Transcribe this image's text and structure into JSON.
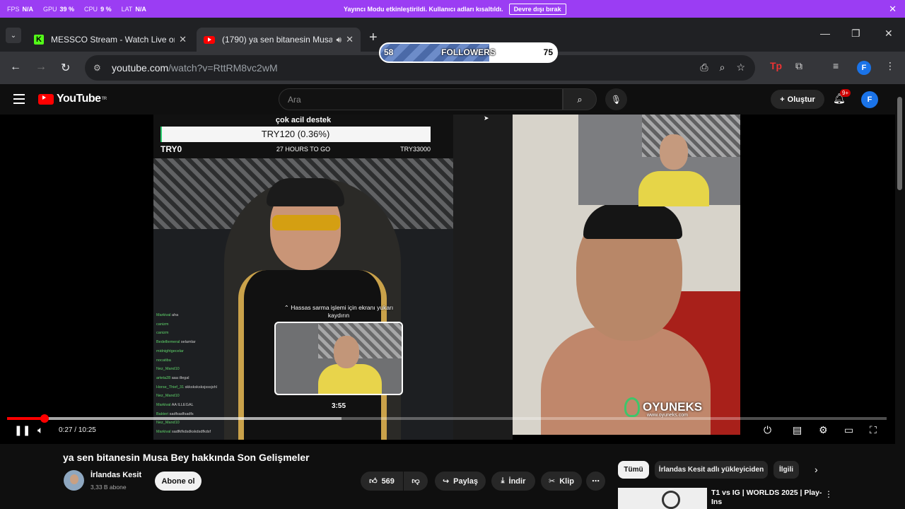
{
  "streamer_bar": {
    "stats": [
      {
        "label": "FPS",
        "value": "N/A"
      },
      {
        "label": "GPU",
        "value": "39 %"
      },
      {
        "label": "CPU",
        "value": "9 %"
      },
      {
        "label": "LAT",
        "value": "N/A"
      }
    ],
    "message": "Yayıncı Modu etkinleştirildi. Kullanıcı adları kısaltıldı.",
    "disable_button": "Devre dışı bırak",
    "color": "#9b3df3"
  },
  "tabs": [
    {
      "title": "MESSCO Stream - Watch Live on K",
      "icon": "kick-icon"
    },
    {
      "title": "(1790) ya sen bitanesin Musa B",
      "icon": "youtube-icon",
      "audio": true,
      "active": true
    }
  ],
  "followers_widget": {
    "label": "FOLLOWERS",
    "current": "58",
    "goal": "75",
    "progress": 0.62
  },
  "omnibox": {
    "url_host": "youtube.com",
    "url_path": "/watch?v=RttRM8vc2wM"
  },
  "profile_letter": "F",
  "youtube": {
    "logo_text": "YouTube",
    "logo_suffix": "TR",
    "search_placeholder": "Ara",
    "create_label": "Oluştur",
    "notification_count": "9+"
  },
  "video": {
    "donation": {
      "title": "çok acil destek",
      "amount": "TRY120 (0.36%)",
      "start": "TRY0",
      "remaining": "27 HOURS TO GO",
      "goal": "TRY33000"
    },
    "chat": [
      {
        "user": "Markival",
        "msg": "aha"
      },
      {
        "user": "canizm",
        "msg": ""
      },
      {
        "user": "canizm",
        "msg": ""
      },
      {
        "user": "Bedelliemeral",
        "msg": "selamlar"
      },
      {
        "user": "midnightgecelar",
        "msg": ""
      },
      {
        "user": "nocatiba",
        "msg": ""
      },
      {
        "user": "Nez_Mand10",
        "msg": ""
      },
      {
        "user": "arteta28",
        "msg": "aaa illegal"
      },
      {
        "user": "Horse_Thief_31",
        "msg": "skksksksksjsssjshl"
      },
      {
        "user": "Nez_Mand10",
        "msg": ""
      },
      {
        "user": "Markival",
        "msg": "AA ILLEGAL"
      },
      {
        "user": "Bakteri",
        "msg": "sadfsadfsadfs"
      },
      {
        "user": "Nez_Mand10",
        "msg": ""
      },
      {
        "user": "Markival",
        "msg": "sadfkfkdsdkskdsdfkdsf"
      }
    ],
    "watermark": "OYUNEKS",
    "watermark_url": "www.oyuneks.com",
    "preview_hint": "Hassas sarma işlemi için ekranı yukarı kaydırın",
    "preview_time": "3:55",
    "current_time": "0:27",
    "duration": "10:25",
    "played_fraction": 0.043,
    "buffered_fraction": 0.38,
    "progress_color": "#ff0000"
  },
  "below": {
    "title": "ya sen bitanesin Musa Bey hakkında Son Gelişmeler",
    "channel": "İrlandas Kesit",
    "subscribers": "3,33 B abone",
    "subscribe_label": "Abone ol",
    "likes": "569",
    "share_label": "Paylaş",
    "download_label": "İndir",
    "clip_label": "Klip"
  },
  "chips": [
    "Tümü",
    "İrlandas Kesit adlı yükleyiciden",
    "İlgili"
  ],
  "recommendation": {
    "title": "T1 vs IG | WORLDS 2025 | Play-Ins"
  }
}
